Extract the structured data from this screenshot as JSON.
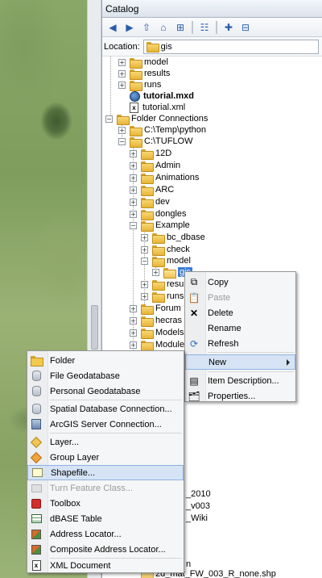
{
  "catalog": {
    "title": "Catalog",
    "location_label": "Location:",
    "location_value": "gis"
  },
  "tree": [
    {
      "label": "model",
      "level": 1
    },
    {
      "label": "results",
      "level": 1
    },
    {
      "label": "runs",
      "level": 1
    },
    {
      "label": "tutorial.mxd",
      "level": 1
    },
    {
      "label": "tutorial.xml",
      "level": 1
    },
    {
      "label": "Folder Connections",
      "level": 0
    },
    {
      "label": "C:\\Temp\\python",
      "level": 1
    },
    {
      "label": "C:\\TUFLOW",
      "level": 1
    },
    {
      "label": "12D",
      "level": 2
    },
    {
      "label": "Admin",
      "level": 2
    },
    {
      "label": "Animations",
      "level": 2
    },
    {
      "label": "ARC",
      "level": 2
    },
    {
      "label": "dev",
      "level": 2
    },
    {
      "label": "dongles",
      "level": 2
    },
    {
      "label": "Example",
      "level": 2
    },
    {
      "label": "bc_dbase",
      "level": 3
    },
    {
      "label": "check",
      "level": 3
    },
    {
      "label": "model",
      "level": 3
    },
    {
      "label": "gis",
      "level": 4
    },
    {
      "label": "resu",
      "level": 3
    },
    {
      "label": "runs",
      "level": 3
    },
    {
      "label": "Forum",
      "level": 2
    },
    {
      "label": "hecras",
      "level": 2
    },
    {
      "label": "Models",
      "level": 2
    },
    {
      "label": "Module",
      "level": 2
    }
  ],
  "tree_bottom": [
    {
      "label": "_2010"
    },
    {
      "label": "_v003"
    },
    {
      "label": "_Wiki"
    },
    {
      "label": "n"
    },
    {
      "label": "2d_mat_FW_003_R_none.shp"
    }
  ],
  "context_menu": {
    "items": [
      "Copy",
      "Paste",
      "Delete",
      "Rename",
      "Refresh",
      "New",
      "Item Description...",
      "Properties..."
    ]
  },
  "new_menu": {
    "items": [
      "Folder",
      "File Geodatabase",
      "Personal Geodatabase",
      "Spatial Database Connection...",
      "ArcGIS Server Connection...",
      "Layer...",
      "Group Layer",
      "Shapefile...",
      "Turn Feature Class...",
      "Toolbox",
      "dBASE Table",
      "Address Locator...",
      "Composite Address Locator...",
      "XML Document"
    ]
  },
  "toolbar_icons": [
    "back-icon",
    "forward-icon",
    "up-icon",
    "home-icon",
    "connect-icon",
    "view-options-icon",
    "new-folder-icon",
    "tree-icon"
  ]
}
